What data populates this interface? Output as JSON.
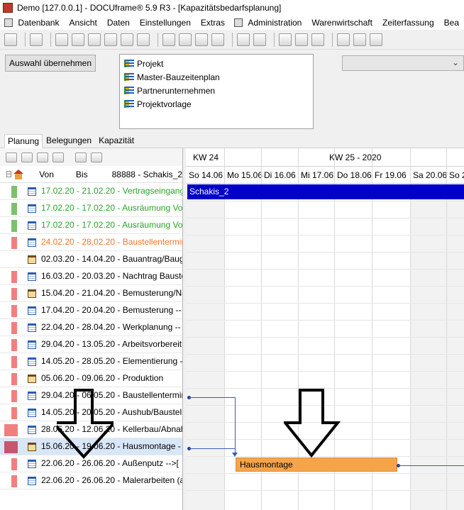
{
  "window": {
    "title": "Demo [127.0.0.1] - DOCUframe® 5.9 R3 - [Kapazitätsbedarfsplanung]"
  },
  "menu": [
    "Datenbank",
    "Ansicht",
    "Daten",
    "Einstellungen",
    "Extras",
    "Administration",
    "Warenwirtschaft",
    "Zeiterfassung",
    "Bea"
  ],
  "selection": {
    "button_label": "Auswahl übernehmen",
    "tree_items": [
      "Projekt",
      "Master-Bauzeitenplan",
      "Partnerunternehmen",
      "Projektvorlage"
    ],
    "dropdown_value": ""
  },
  "tabs": [
    "Planung",
    "Belegungen",
    "Kapazität"
  ],
  "list": {
    "headers": {
      "von": "Von",
      "bis": "Bis",
      "project": "88888 - Schakis_2"
    },
    "rows": [
      {
        "text": "17.02.20 - 21.02.20 - Vertragseingang/",
        "color": "#2aa52a",
        "mark": "#7dbf6e",
        "icon": "cal"
      },
      {
        "text": "17.02.20 - 17.02.20 - Ausräumung Vor",
        "color": "#2aa52a",
        "mark": "#7dbf6e",
        "icon": "cal"
      },
      {
        "text": "17.02.20 - 17.02.20 - Ausräumung Vor",
        "color": "#2aa52a",
        "mark": "#7dbf6e",
        "icon": "cal"
      },
      {
        "text": "24.02.20 - 28.02.20 - Baustellentermin",
        "color": "#f0772c",
        "mark": "#f08080",
        "icon": "cal"
      },
      {
        "text": "02.03.20 - 14.04.20 - Bauantrag/Baug",
        "color": "#000000",
        "mark": "",
        "icon": "clip"
      },
      {
        "text": "16.03.20 - 20.03.20 - Nachtrag Bauste",
        "color": "#000000",
        "mark": "#f08080",
        "icon": "cal"
      },
      {
        "text": "15.04.20 - 21.04.20 - Bemusterung/Na",
        "color": "#000000",
        "mark": "#f08080",
        "icon": "clip"
      },
      {
        "text": "17.04.20 - 20.04.20 - Bemusterung    --",
        "color": "#000000",
        "mark": "#f08080",
        "icon": "cal"
      },
      {
        "text": "22.04.20 - 28.04.20 - Werkplanung    --",
        "color": "#000000",
        "mark": "#f08080",
        "icon": "cal"
      },
      {
        "text": "29.04.20 - 13.05.20 - Arbeitsvorbereitu",
        "color": "#000000",
        "mark": "#f08080",
        "icon": "cal"
      },
      {
        "text": "14.05.20 - 28.05.20 - Elementierung  -",
        "color": "#000000",
        "mark": "#f08080",
        "icon": "cal"
      },
      {
        "text": "05.06.20 - 09.06.20 - Produktion",
        "color": "#000000",
        "mark": "#f08080",
        "icon": "clip"
      },
      {
        "text": "29.04.20 - 06.05.20 - Baustellentermin",
        "color": "#000000",
        "mark": "#f08080",
        "icon": "cal"
      },
      {
        "text": "14.05.20 - 20.05.20 - Aushub/Baustell",
        "color": "#000000",
        "mark": "#f08080",
        "icon": "cal"
      },
      {
        "text": "28.05.20 - 12.06.20 - Kellerbau/Abnah",
        "color": "#000000",
        "mark": "#f08080",
        "icon": "cal"
      },
      {
        "text": "15.06.20 - 19.06.20 - Hausmontage   -",
        "color": "#000000",
        "mark": "#c4566e",
        "icon": "clip"
      },
      {
        "text": "22.06.20 - 26.06.20 - Außenputz  -->[",
        "color": "#000000",
        "mark": "#f08080",
        "icon": "cal"
      },
      {
        "text": "22.06.20 - 26.06.20 - Malerarbeiten (au",
        "color": "#000000",
        "mark": "#f08080",
        "icon": "cal"
      }
    ]
  },
  "gantt": {
    "weeks": [
      "KW 24",
      "KW 25 - 2020"
    ],
    "days": [
      "So 14.06",
      "Mo 15.06",
      "Di 16.06",
      "Mi 17.06",
      "Do 18.06",
      "Fr 19.06",
      "Sa 20.06",
      "So 2"
    ],
    "project_bar_label": "Schakis_2",
    "task_bar_label": "Hausmontage",
    "colors": {
      "project_bar": "#0000c8",
      "task_bar": "#f5a44a"
    }
  }
}
